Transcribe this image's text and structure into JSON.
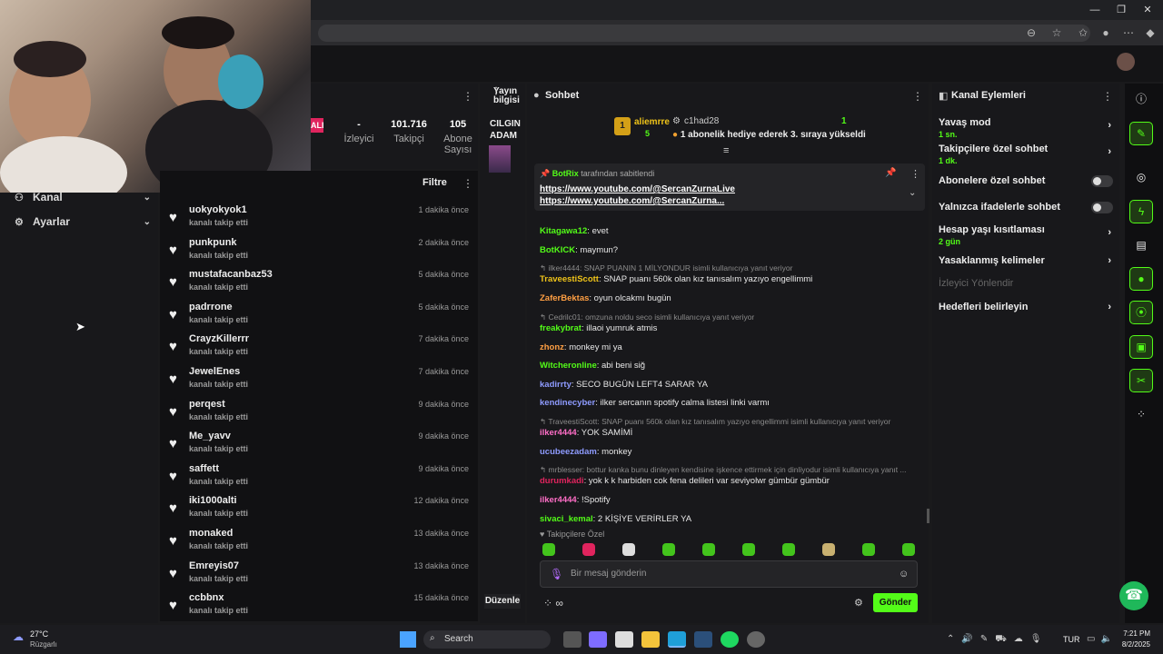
{
  "browser": {
    "window_controls": [
      "—",
      "❐",
      "✕"
    ]
  },
  "stats": {
    "badge": "ALI",
    "items": [
      {
        "num": "-",
        "label": "İzleyici"
      },
      {
        "num": "101.716",
        "label": "Takipçi"
      },
      {
        "num": "105",
        "label": "Abone Sayısı"
      }
    ]
  },
  "leftnav": {
    "items": [
      {
        "label": "Kanal"
      },
      {
        "label": "Ayarlar"
      }
    ]
  },
  "follows": {
    "filter_label": "Filtre",
    "subtitle": "kanalı takip etti",
    "rows": [
      {
        "name": "uokyokyok1",
        "time": "1 dakika önce"
      },
      {
        "name": "punkpunk",
        "time": "2 dakika önce"
      },
      {
        "name": "mustafacanbaz53",
        "time": "5 dakika önce"
      },
      {
        "name": "padrrone",
        "time": "5 dakika önce"
      },
      {
        "name": "CrayzKillerrr",
        "time": "7 dakika önce"
      },
      {
        "name": "JewelEnes",
        "time": "7 dakika önce"
      },
      {
        "name": "perqest",
        "time": "9 dakika önce"
      },
      {
        "name": "Me_yavv",
        "time": "9 dakika önce"
      },
      {
        "name": "saffett",
        "time": "9 dakika önce"
      },
      {
        "name": "iki1000alti",
        "time": "12 dakika önce"
      },
      {
        "name": "monaked",
        "time": "13 dakika önce"
      },
      {
        "name": "Emreyis07",
        "time": "13 dakika önce"
      },
      {
        "name": "ccbbnx",
        "time": "15 dakika önce"
      }
    ]
  },
  "stream_info": {
    "title": "Yayın bilgisi",
    "stream_title": "CILGIN ADAM",
    "edit_label": "Düzenle"
  },
  "chat": {
    "title": "Sohbet",
    "gift": {
      "rank": "1",
      "user": "aliemrre",
      "count": "5",
      "target": "c1had28",
      "target_count": "1",
      "message": "1 abonelik hediye ederek 3. sıraya yükseldi"
    },
    "pinned": {
      "by": "BotRix",
      "by_suffix": "tarafından sabitlendi",
      "links": [
        "https://www.youtube.com/@SercanZurnaLive",
        "https://www.youtube.com/@SercanZurna..."
      ]
    },
    "messages": [
      {
        "reply": "",
        "user": "Kitagawa12",
        "text": "evet",
        "color": "#53fc18"
      },
      {
        "reply": "",
        "user": "BotKICK",
        "text": "maymun?",
        "color": "#53fc18"
      },
      {
        "reply": "ilker4444: SNAP PUANIN 1 MİLYONDUR isimli kullanıcıya yanıt veriyor",
        "user": "TraveestiScott",
        "text": "SNAP puanı 560k olan kız tanısalım yazıyo engellimmi",
        "color": "#f0c419"
      },
      {
        "reply": "",
        "user": "ZaferBektas",
        "text": "oyun olcakmı bugün",
        "color": "#ff9f43"
      },
      {
        "reply": "Cedrilc01: omzuna noldu seco isimli kullanıcıya yanıt veriyor",
        "user": "freakybrat",
        "text": "illaoi yumruk atmis",
        "color": "#53fc18"
      },
      {
        "reply": "",
        "user": "zhonz",
        "text": "monkey mi ya",
        "color": "#ff9f43"
      },
      {
        "reply": "",
        "user": "Witcheronline",
        "text": "abi beni siğ",
        "color": "#53fc18"
      },
      {
        "reply": "",
        "user": "kadirrty",
        "text": "SECO BUGÜN LEFT4 SARAR YA",
        "color": "#8e9bff"
      },
      {
        "reply": "",
        "user": "kendinecyber",
        "text": "ilker sercanın spotify calma listesi linki varmı",
        "color": "#8e9bff"
      },
      {
        "reply": "TraveestiScott: SNAP puanı 560k olan kız tanısalım yazıyo engellimmi isimli kullanıcıya yanıt veriyor",
        "user": "ilker4444",
        "text": "YOK SAMİMİ",
        "color": "#ff6ec7"
      },
      {
        "reply": "",
        "user": "ucubeezadam",
        "text": "monkey",
        "color": "#8e9bff"
      },
      {
        "reply": "mrblesser: bottur kanka bunu dinleyen kendisine işkence ettirmek için dinliyodur isimli kullanıcıya yanıt ...",
        "user": "durumkadi",
        "text": "yok k k harbiden cok fena delileri var seviyolwr gümbür gümbür",
        "color": "#e0245e"
      },
      {
        "reply": "",
        "user": "ilker4444",
        "text": "!Spotify",
        "color": "#ff6ec7"
      },
      {
        "reply": "",
        "user": "sivaci_kemal",
        "text": "2 KİŞİYE VERİRLER YA",
        "color": "#53fc18"
      }
    ],
    "followers_only": "Takipçilere Özel",
    "input_placeholder": "Bir mesaj gönderin",
    "send_label": "Gönder"
  },
  "actions": {
    "title": "Kanal Eylemleri",
    "items": [
      {
        "label": "Yavaş mod",
        "sub": "1 sn."
      },
      {
        "label": "Takipçilere özel sohbet",
        "sub": "1 dk."
      },
      {
        "label": "Abonelere özel sohbet",
        "sub": ""
      },
      {
        "label": "Yalnızca ifadelerle sohbet",
        "sub": ""
      },
      {
        "label": "Hesap yaşı kısıtlaması",
        "sub": "2 gün"
      },
      {
        "label": "Yasaklanmış kelimeler",
        "sub": ""
      },
      {
        "label": "İzleyici Yönlendir",
        "sub": ""
      },
      {
        "label": "Hedefleri belirleyin",
        "sub": ""
      }
    ]
  },
  "taskbar": {
    "weather_temp": "27°C",
    "weather_text": "Rüzgarlı",
    "search_placeholder": "Search",
    "lang": "TUR",
    "time": "7:21 PM",
    "date": "8/2/2025"
  }
}
